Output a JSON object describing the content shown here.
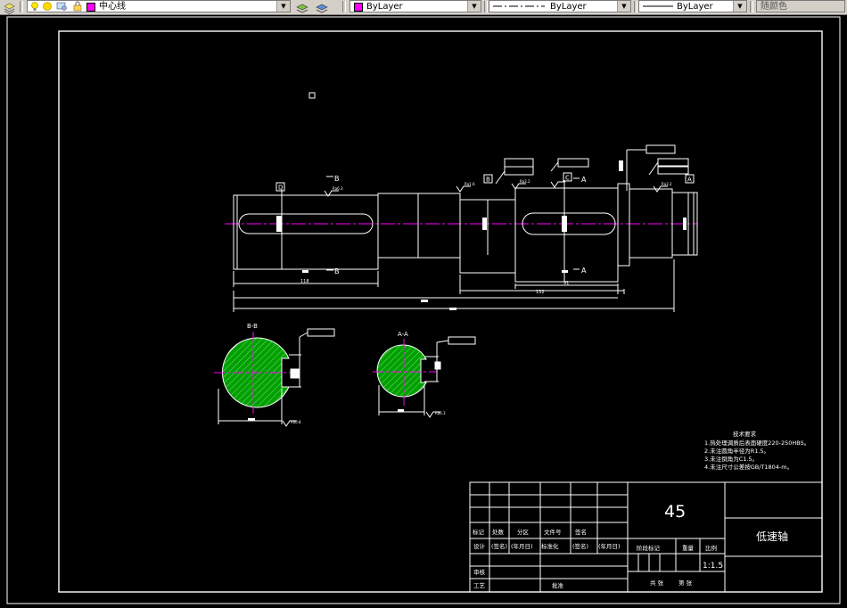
{
  "toolbar": {
    "layer_name": "中心线",
    "layer_color": "#ff00ff",
    "color_value": "ByLayer",
    "color_swatch": "#ff00ff",
    "linetype_value": "ByLayer",
    "lineweight_value": "ByLayer",
    "plotstyle_value": "随颜色"
  },
  "drawing": {
    "colors": {
      "background": "#000000",
      "lines": "#ffffff",
      "centerline": "#ff00ff",
      "hatch": "#00a000"
    },
    "section_labels": [
      "B-B",
      "A-A"
    ],
    "datums": [
      "D",
      "B",
      "C",
      "A"
    ],
    "cut_arrows": [
      "B",
      "B",
      "A",
      "A"
    ],
    "dimensions": {
      "len_keyseat_1": "118",
      "len_keyseat_2": "91",
      "len_right": "132"
    },
    "roughness": [
      "Ra6.3",
      "Ra1.6",
      "Ra3.2",
      "Ra3.2",
      "Ra0.8",
      "Ra6.3",
      "Ra3.2"
    ],
    "tech_requirements": {
      "title": "技术要求",
      "items": [
        "1.热处理调质后表面硬度220-250HBS。",
        "2.未注圆角半径为R1.5。",
        "3.未注倒角为C1.5。",
        "4.未注尺寸公差按GB/T1804-m。"
      ]
    },
    "title_block": {
      "material": "45",
      "part_name": "低速轴",
      "headers_row1": [
        "标记",
        "处数",
        "分区",
        "文件号",
        "签名"
      ],
      "headers_row2": [
        "设计",
        "(签名)",
        "(年月日)",
        "标准化",
        "(签名)",
        "(年月日)"
      ],
      "stage_mark": "阶段标记",
      "weight": "重量",
      "scale_label": "比例",
      "scale_value": "1:1.5",
      "review": "审核",
      "process": "工艺",
      "approve": "批准",
      "sheets_total": "共  张",
      "sheet_no": "第  张"
    }
  }
}
